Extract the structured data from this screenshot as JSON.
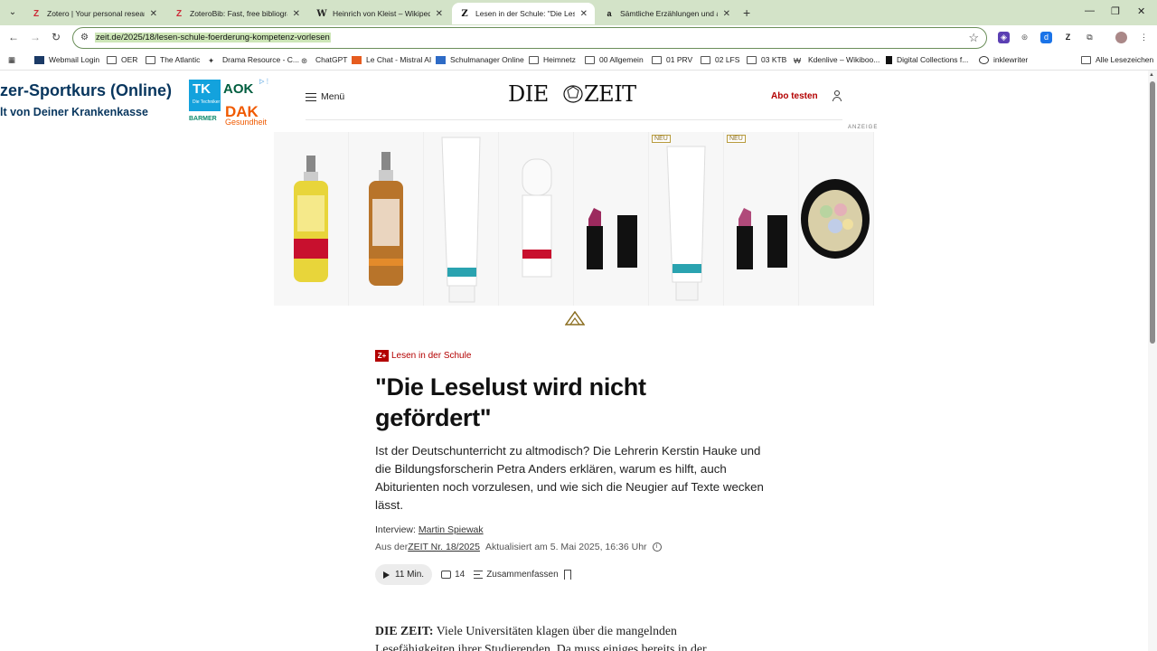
{
  "browser": {
    "tabs": [
      {
        "title": "Zotero | Your personal research",
        "icon": "zotero-icon",
        "active": false
      },
      {
        "title": "ZoteroBib: Fast, free bibliograph",
        "icon": "zoterobib-icon",
        "active": false
      },
      {
        "title": "Heinrich von Kleist – Wikipedia",
        "icon": "wikipedia-icon",
        "active": false
      },
      {
        "title": "Lesen in der Schule: \"Die Leselu",
        "icon": "zeit-icon",
        "active": true
      },
      {
        "title": "Sämtliche Erzählungen und and",
        "icon": "amazon-icon",
        "active": false
      }
    ],
    "url": "zeit.de/2025/18/lesen-schule-foerderung-kompetenz-vorlesen",
    "bookmarks": [
      {
        "label": "Webmail Login",
        "icon": "webmail-icon"
      },
      {
        "label": "OER",
        "icon": "folder-icon"
      },
      {
        "label": "The Atlantic",
        "icon": "folder-icon"
      },
      {
        "label": "Drama Resource - C...",
        "icon": "drama-icon"
      },
      {
        "label": "ChatGPT",
        "icon": "chatgpt-icon"
      },
      {
        "label": "Le Chat - Mistral AI",
        "icon": "mistral-icon"
      },
      {
        "label": "Schulmanager Online",
        "icon": "schulmanager-icon"
      },
      {
        "label": "Heimnetz",
        "icon": "folder-icon"
      },
      {
        "label": "00 Allgemein",
        "icon": "folder-icon"
      },
      {
        "label": "01 PRV",
        "icon": "folder-icon"
      },
      {
        "label": "02 LFS",
        "icon": "folder-icon"
      },
      {
        "label": "03 KTB",
        "icon": "folder-icon"
      },
      {
        "label": "Kdenlive – Wikiboo...",
        "icon": "wikibooks-icon"
      },
      {
        "label": "Digital Collections f...",
        "icon": "collections-icon"
      },
      {
        "label": "inklewriter",
        "icon": "inklewriter-icon"
      },
      {
        "label": "Alle Lesezeichen",
        "icon": "folder-icon"
      }
    ]
  },
  "ad_top": {
    "line1": "zer-Sportkurs (Online)",
    "line2": "lt von Deiner Krankenkasse",
    "tk": "TK",
    "tk_sub": "Die Techniker",
    "aok": "AOK",
    "barmer": "BARMER",
    "dak": "DAK",
    "dak_sub": "Gesundheit"
  },
  "site_header": {
    "menu_label": "Menü",
    "logo": "DIE ZEIT",
    "subscribe_label": "Abo testen"
  },
  "ad_products": {
    "label": "ANZEIGE",
    "new_badge": "NEU"
  },
  "article": {
    "kicker_badge": "Z+",
    "kicker": "Lesen in der Schule",
    "headline": "\"Die Leselust wird nicht gefördert\"",
    "lead": "Ist der Deutschunterricht zu altmodisch? Die Lehrerin Kerstin Hauke und die Bildungsforscherin Petra Anders erklären, warum es hilft, auch Abiturienten noch vorzulesen, und wie sich die Neugier auf Texte wecken lässt.",
    "byline_prefix": "Interview: ",
    "author": "Martin Spiewak",
    "source_prefix": "Aus der ",
    "source_issue": "ZEIT Nr. 18/2025",
    "updated": "Aktualisiert am 5. Mai 2025, 16:36 Uhr",
    "listen_label": "11 Min.",
    "comments_count": "14",
    "summarize_label": "Zusammenfassen",
    "body_speaker": "DIE ZEIT:",
    "body_text": " Viele Universitäten klagen über die mangelnden Lesefähigkeiten ihrer Studierenden. Da muss einiges bereits in der"
  }
}
